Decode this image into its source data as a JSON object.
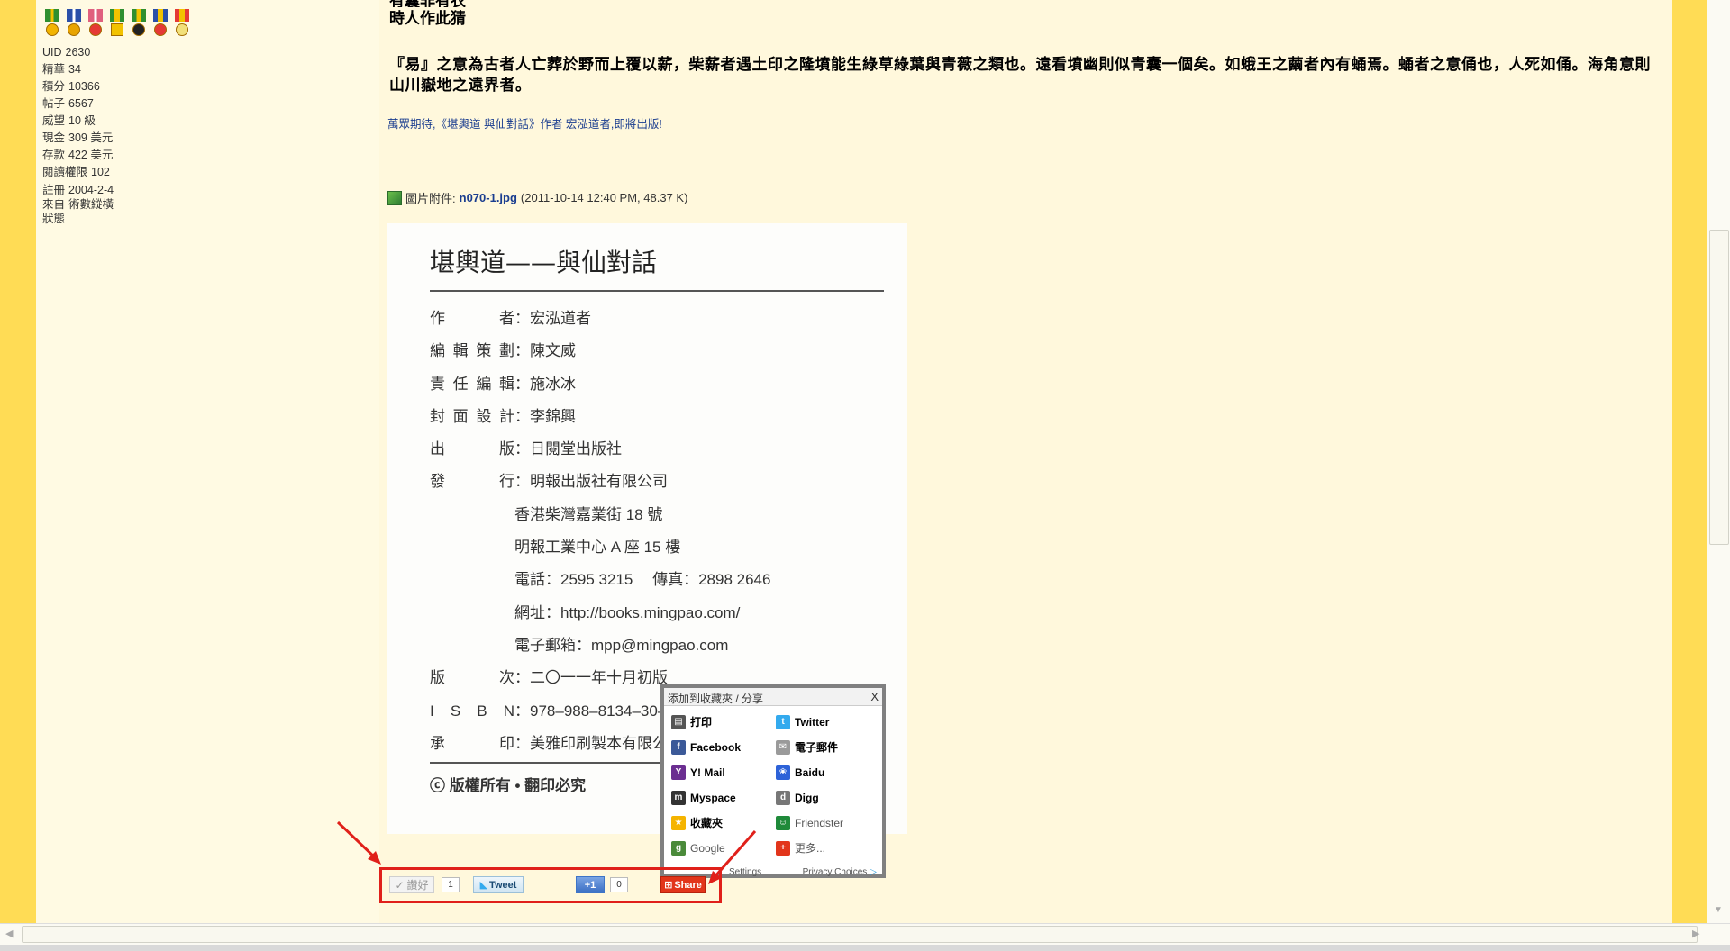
{
  "sidebar": {
    "medals_count": 7,
    "stats": [
      {
        "label": "UID",
        "value": "2630"
      },
      {
        "label": "精華",
        "value": "34"
      },
      {
        "label": "積分",
        "value": "10366"
      },
      {
        "label": "帖子",
        "value": "6567"
      },
      {
        "label": "威望",
        "value": "10 級"
      },
      {
        "label": "現金",
        "value": "309 美元"
      },
      {
        "label": "存款",
        "value": "422 美元"
      },
      {
        "label": "閱讀權限",
        "value": "102"
      },
      {
        "label": "註冊",
        "value": "2004-2-4"
      },
      {
        "label": "來自",
        "value": "術數縱橫"
      },
      {
        "label": "狀態",
        "value": "..."
      }
    ]
  },
  "post": {
    "poem_line1": "有囊非有衣",
    "poem_line2": "時人作此猜",
    "paragraph": "『易』之意為古者人亡葬於野而上覆以薪，柴薪者遇土印之隆墳能生綠草綠葉與青薇之類也。遠看墳幽則似青囊一個矣。如蛾王之繭者內有蛹焉。蛹者之意俑也，人死如俑。海角意則山川嶽地之遠界者。",
    "announcement": "萬眾期待,《堪輿道 與仙對話》作者 宏泓道者,即將出版!",
    "attachment": {
      "prefix": "圖片附件:",
      "filename": "n070-1.jpg",
      "meta": "(2011-10-14 12:40 PM, 48.37 K)"
    }
  },
  "book": {
    "title": "堪輿道——與仙對話",
    "rows": [
      {
        "label": "作　　者",
        "value": "：宏泓道者"
      },
      {
        "label": "編輯策劃",
        "value": "：陳文威"
      },
      {
        "label": "責任編輯",
        "value": "：施冰冰"
      },
      {
        "label": "封面設計",
        "value": "：李錦興"
      },
      {
        "label": "出　　版",
        "value": "：日閱堂出版社"
      },
      {
        "label": "發　　行",
        "value": "：明報出版社有限公司"
      }
    ],
    "address_lines": [
      "香港柴灣嘉業街 18 號",
      "明報工業中心 A 座 15 樓",
      "電話：2595 3215　 傳真：2898 2646",
      "網址：http://books.mingpao.com/",
      "電子郵箱：mpp@mingpao.com"
    ],
    "rows2": [
      {
        "label": "版　　次",
        "value": "：二〇一一年十月初版"
      },
      {
        "label": "I S B N",
        "value": "：978–988–8134–30–"
      },
      {
        "label": "承　　印",
        "value": "：美雅印刷製本有限公"
      }
    ],
    "copyright": "ⓒ 版權所有 • 翻印必究"
  },
  "share_popup": {
    "title": "添加到收藏夾 / 分享",
    "close": "X",
    "items": [
      {
        "label": "打印",
        "icon": "printer-icon",
        "color": "#555555",
        "glyph": "▤",
        "style": "bold"
      },
      {
        "label": "Twitter",
        "icon": "twitter-icon",
        "color": "#33aaee",
        "glyph": "t",
        "style": "bold"
      },
      {
        "label": "Facebook",
        "icon": "facebook-icon",
        "color": "#3b5998",
        "glyph": "f",
        "style": "bold"
      },
      {
        "label": "電子郵件",
        "icon": "email-icon",
        "color": "#9a9a9a",
        "glyph": "✉",
        "style": "bold"
      },
      {
        "label": "Y! Mail",
        "icon": "yahoo-mail-icon",
        "color": "#6b2e91",
        "glyph": "Y",
        "style": "bold"
      },
      {
        "label": "Baidu",
        "icon": "baidu-icon",
        "color": "#2d62d8",
        "glyph": "❀",
        "style": "bold"
      },
      {
        "label": "Myspace",
        "icon": "myspace-icon",
        "color": "#333333",
        "glyph": "m",
        "style": "bold"
      },
      {
        "label": "Digg",
        "icon": "digg-icon",
        "color": "#777777",
        "glyph": "d",
        "style": "bold"
      },
      {
        "label": "收藏夾",
        "icon": "favorites-icon",
        "color": "#f5b400",
        "glyph": "★",
        "style": "bold"
      },
      {
        "label": "Friendster",
        "icon": "friendster-icon",
        "color": "#1f8a3a",
        "glyph": "☺",
        "style": "grey"
      },
      {
        "label": "Google",
        "icon": "google-icon",
        "color": "#4a8a3a",
        "glyph": "g",
        "style": "grey"
      },
      {
        "label": "更多...",
        "icon": "more-plus-icon",
        "color": "#e2351b",
        "glyph": "+",
        "style": "grey"
      }
    ],
    "footer_settings": "Settings",
    "footer_privacy": "Privacy Choices"
  },
  "social": {
    "like_label": "讚好",
    "like_count": "1",
    "tweet_label": "Tweet",
    "plusone_label": "+1",
    "plusone_count": "0",
    "share_label": "Share"
  },
  "colors": {
    "border_yellow": "#ffdc55",
    "content_bg": "#fff8dc",
    "annotation_red": "#e0201a",
    "link_blue": "#1a3d8f"
  }
}
